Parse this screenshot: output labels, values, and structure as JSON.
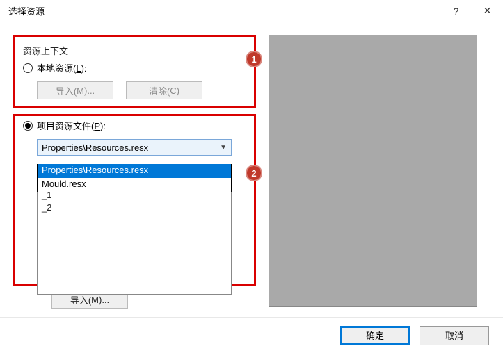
{
  "titlebar": {
    "title": "选择资源",
    "help_glyph": "?",
    "close_glyph": "✕"
  },
  "group1": {
    "legend": "资源上下文",
    "local_label_pre": "本地资源(",
    "local_label_key": "L",
    "local_label_post": "):",
    "import_pre": "导入(",
    "import_key": "M",
    "import_post": ")...",
    "clear_pre": "清除(",
    "clear_key": "C",
    "clear_post": ")"
  },
  "group2": {
    "radio_label_pre": "项目资源文件(",
    "radio_label_key": "P",
    "radio_label_post": "):",
    "combo_selected": "Properties\\Resources.resx",
    "dropdown_option1": "Properties\\Resources.resx",
    "dropdown_option2": "Mould.resx",
    "list_item1": "_1",
    "list_item2": "_2",
    "import_pre": "导入(",
    "import_key": "M",
    "import_post": ")..."
  },
  "markers": {
    "one": "1",
    "two": "2"
  },
  "footer": {
    "ok": "确定",
    "cancel": "取消"
  }
}
